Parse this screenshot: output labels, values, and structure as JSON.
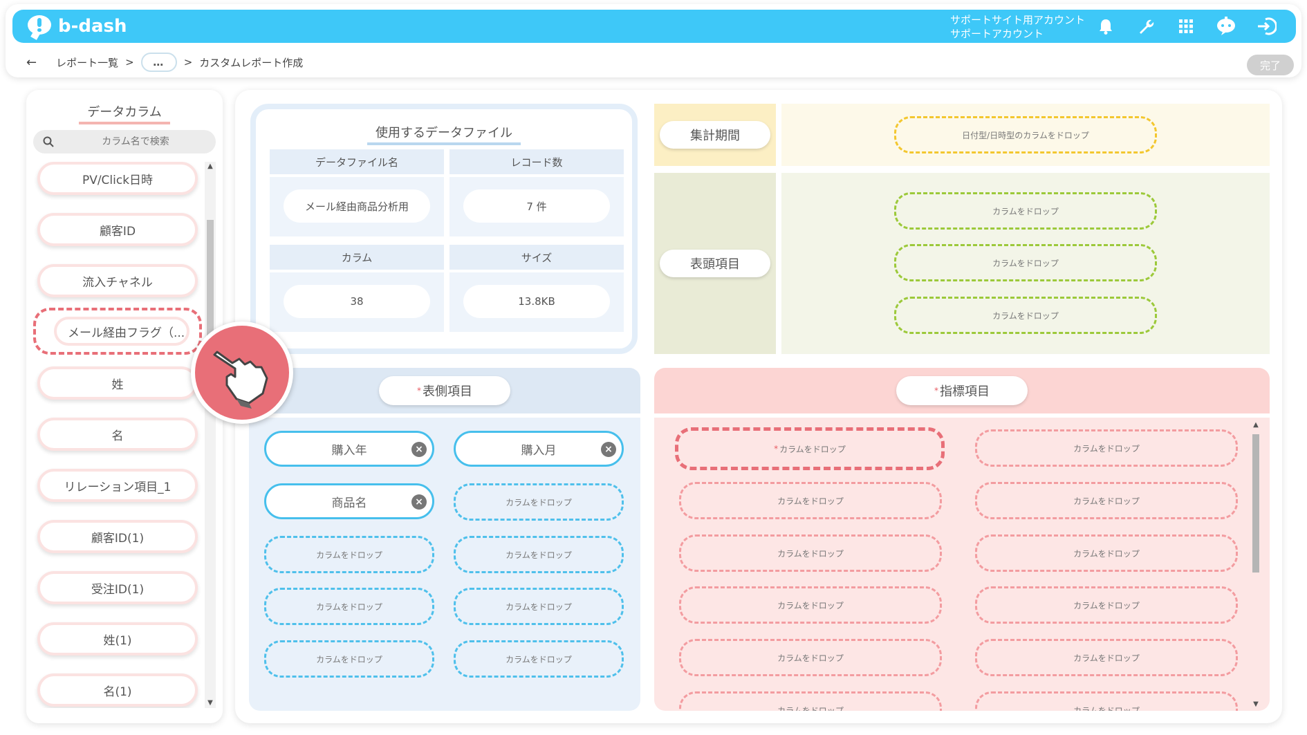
{
  "app": {
    "logo_text": "b-dash",
    "account_line1": "サポートサイト用アカウント",
    "account_line2": "サポートアカウント",
    "icons": [
      "bell-icon",
      "wrench-icon",
      "grid-icon",
      "chatbot-icon",
      "logout-icon"
    ]
  },
  "breadcrumb": {
    "back": "←",
    "item1": "レポート一覧",
    "sep1": ">",
    "more": "…",
    "sep2": ">",
    "item2": "カスタムレポート作成"
  },
  "done_button": "完了",
  "sidebar": {
    "title": "データカラム",
    "search_placeholder": "カラム名で検索",
    "items": [
      {
        "label": "PV/Click日時"
      },
      {
        "label": "顧客ID"
      },
      {
        "label": "流入チャネル"
      },
      {
        "label": "メール経由フラグ（..."
      },
      {
        "label": "姓"
      },
      {
        "label": "名"
      },
      {
        "label": "リレーション項目_1"
      },
      {
        "label": "顧客ID(1)"
      },
      {
        "label": "受注ID(1)"
      },
      {
        "label": "姓(1)"
      },
      {
        "label": "名(1)"
      }
    ]
  },
  "data_file": {
    "title": "使用するデータファイル",
    "name_header": "データファイル名",
    "records_header": "レコード数",
    "name_value": "メール経由商品分析用",
    "records_value": "7 件",
    "columns_header": "カラム",
    "size_header": "サイズ",
    "columns_value": "38",
    "size_value": "13.8KB"
  },
  "period": {
    "label": "集計期間",
    "drop": "日付型/日時型のカラムをドロップ"
  },
  "header_items": {
    "label": "表頭項目",
    "drops": [
      "カラムをドロップ",
      "カラムをドロップ",
      "カラムをドロップ"
    ]
  },
  "side_items": {
    "label": "表側項目",
    "required_mark": "*",
    "chips": [
      "購入年",
      "購入月",
      "商品名"
    ],
    "drop": "カラムをドロップ"
  },
  "metric_items": {
    "label": "指標項目",
    "required_mark": "*",
    "first_required_mark": "*",
    "drop": "カラムをドロップ"
  },
  "colors": {
    "primary": "#3ec8f8",
    "accent_red": "#e86f78",
    "period_bg": "#fdf9e9",
    "header_bg": "#f3f5e8",
    "side_bg": "#e9f1fa",
    "metric_bg": "#fde1e0"
  }
}
